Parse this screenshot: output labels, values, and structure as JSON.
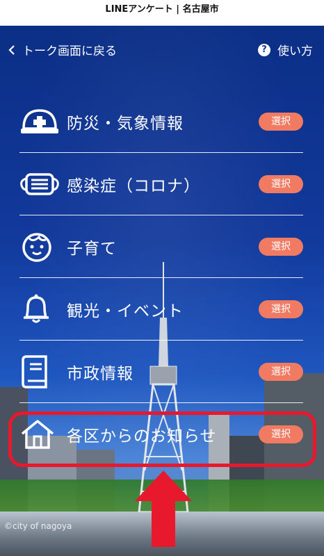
{
  "app": {
    "title": "LINEアンケート | 名古屋市"
  },
  "header": {
    "back_label": "トーク画面に戻る",
    "help_label": "使い方",
    "help_icon_glyph": "?"
  },
  "menu": {
    "button_label": "選択",
    "button_color": "#f07b62",
    "items": [
      {
        "label": "防災・気象情報",
        "icon": "helmet-icon"
      },
      {
        "label": "感染症（コロナ）",
        "icon": "mask-icon"
      },
      {
        "label": "子育て",
        "icon": "baby-face-icon"
      },
      {
        "label": "観光・イベント",
        "icon": "bell-icon"
      },
      {
        "label": "市政情報",
        "icon": "book-icon"
      },
      {
        "label": "各区からのお知らせ",
        "icon": "house-icon"
      }
    ]
  },
  "footer": {
    "copyright": "©city of nagoya"
  },
  "colors": {
    "background_blue": "#12399c",
    "highlight_red": "#e8192c"
  }
}
